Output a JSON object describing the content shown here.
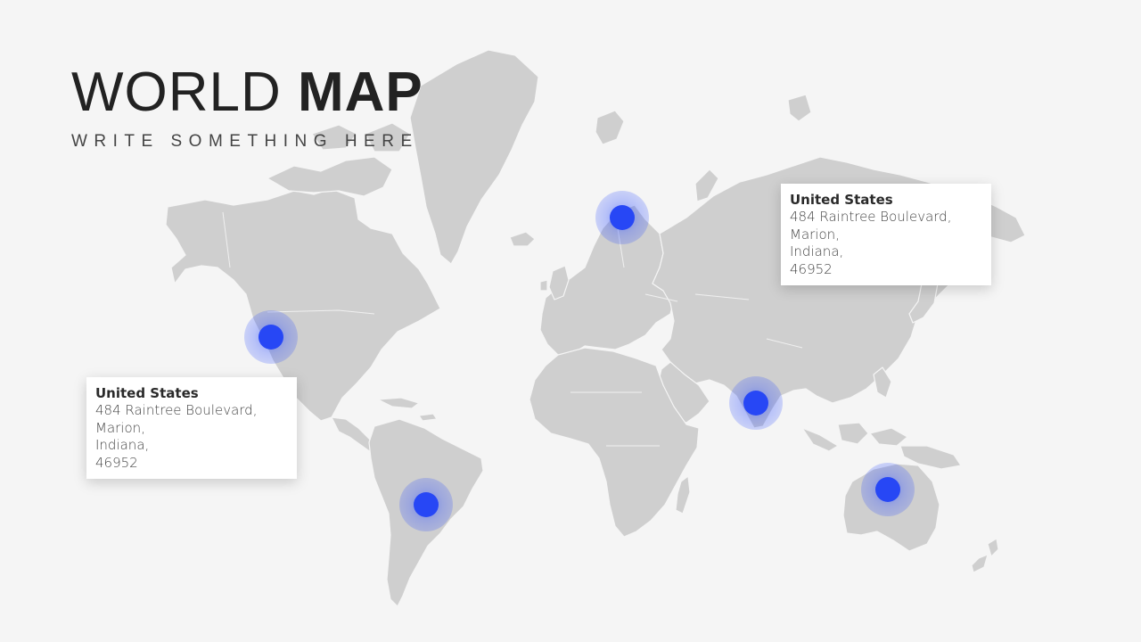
{
  "title": {
    "light": "WORLD",
    "bold": "MAP"
  },
  "subtitle": "WRITE SOMETHING HERE",
  "colors": {
    "background": "#f5f5f5",
    "land": "#cfcfcf",
    "pin": "#2747f5",
    "title": "#222222"
  },
  "pins": [
    {
      "name": "west-coast-north-america"
    },
    {
      "name": "scandinavia"
    },
    {
      "name": "south-america"
    },
    {
      "name": "india"
    },
    {
      "name": "australia"
    }
  ],
  "cards": [
    {
      "title": "United States",
      "lines": [
        "484  Raintree Boulevard,",
        "Marion,",
        "Indiana,",
        "46952"
      ]
    },
    {
      "title": "United States",
      "lines": [
        "484  Raintree Boulevard,",
        "Marion,",
        "Indiana,",
        "46952"
      ]
    }
  ]
}
